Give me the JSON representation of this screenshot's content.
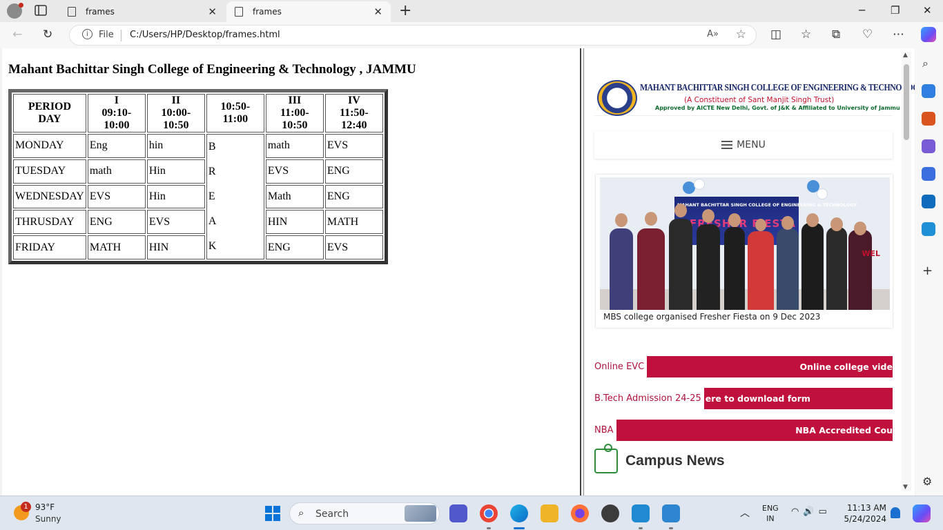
{
  "browser": {
    "tabs": [
      {
        "label": "frames",
        "active": false
      },
      {
        "label": "frames",
        "active": true
      }
    ],
    "address": {
      "scheme_label": "File",
      "url": "C:/Users/HP/Desktop/frames.html"
    }
  },
  "left_frame": {
    "title": "Mahant Bachittar Singh College of Engineering & Technology , JAMMU",
    "timetable": {
      "header": {
        "corner_line1": "PERIOD",
        "corner_line2": "DAY",
        "periods": [
          {
            "name": "I",
            "time": "09:10-10:00"
          },
          {
            "name": "II",
            "time": "10:00-10:50"
          },
          {
            "name": "",
            "time": "10:50-11:00"
          },
          {
            "name": "III",
            "time": "11:00-10:50"
          },
          {
            "name": "IV",
            "time": "11:50-12:40"
          }
        ]
      },
      "break_letters": [
        "B",
        "R",
        "E",
        "A",
        "K"
      ],
      "rows": [
        {
          "day": "MONDAY",
          "p1": "Eng",
          "p2": "hin",
          "p3": "math",
          "p4": "EVS"
        },
        {
          "day": "TUESDAY",
          "p1": "math",
          "p2": "Hin",
          "p3": "EVS",
          "p4": "ENG"
        },
        {
          "day": "WEDNESDAY",
          "p1": "EVS",
          "p2": "Hin",
          "p3": "Math",
          "p4": "ENG"
        },
        {
          "day": "THRUSDAY",
          "p1": "ENG",
          "p2": "EVS",
          "p3": "HIN",
          "p4": "MATH"
        },
        {
          "day": "FRIDAY",
          "p1": "MATH",
          "p2": "HIN",
          "p3": "ENG",
          "p4": "EVS"
        }
      ]
    }
  },
  "right_frame": {
    "header": {
      "name": "MAHANT BACHITTAR SINGH COLLEGE OF ENGINEERING & TECHNOLOGY",
      "subtitle": "(A Constituent of Sant Manjit Singh Trust)",
      "approval": "Approved by AICTE New Delhi, Govt. of J&K & Affiliated to University of Jammu"
    },
    "menu_label": "MENU",
    "news": {
      "banner_text": "MAHANT BACHITTAR SINGH COLLEGE OF ENGINEERING & TECHNOLOGY",
      "banner_event": "FRESHER FIESTA",
      "caption": "MBS college organised Fresher Fiesta on 9 Dec 2023",
      "welcome": "WEL"
    },
    "tickers": [
      {
        "label": "Online EVC",
        "scroll": "Online college vide"
      },
      {
        "label": "B.Tech Admission 24-25",
        "scroll": "ere to download form"
      },
      {
        "label": "NBA",
        "scroll": "NBA Accredited Cou"
      }
    ],
    "campus_news": "Campus News"
  },
  "taskbar": {
    "weather": {
      "badge": "1",
      "temp": "93°F",
      "desc": "Sunny"
    },
    "search_placeholder": "Search",
    "lang_line1": "ENG",
    "lang_line2": "IN",
    "time": "11:13 AM",
    "date": "5/24/2024"
  },
  "colors": {
    "ticker_red": "#c0113c",
    "brand_blue": "#1a2a6c",
    "accent_green": "#2e8b3a"
  }
}
